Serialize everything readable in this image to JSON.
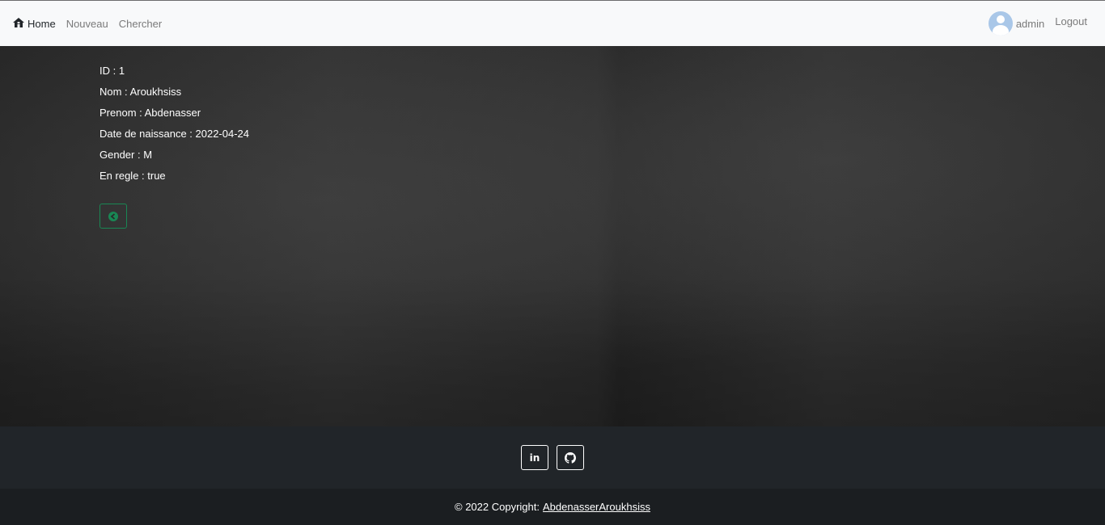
{
  "navbar": {
    "home_label": "Home",
    "new_label": "Nouveau",
    "search_label": "Chercher",
    "username": "admin",
    "logout_label": "Logout"
  },
  "details": [
    "ID : 1",
    "Nom : Aroukhsiss",
    "Prenom : Abdenasser",
    "Date de naissance : 2022-04-24",
    "Gender : M",
    "En regle : true"
  ],
  "icons": {
    "home": "home-icon",
    "avatar": "user-avatar-icon",
    "back": "arrow-left-circle-icon",
    "linkedin": "linkedin-icon",
    "github": "github-icon"
  },
  "footer": {
    "copyright_prefix": "© 2022 Copyright:",
    "copyright_link": "AbdenasserAroukhsiss",
    "linkedin_glyph": "in"
  },
  "colors": {
    "accent_green": "#198754",
    "navbar_bg": "#f8f9fa",
    "footer_bg": "#212529"
  }
}
